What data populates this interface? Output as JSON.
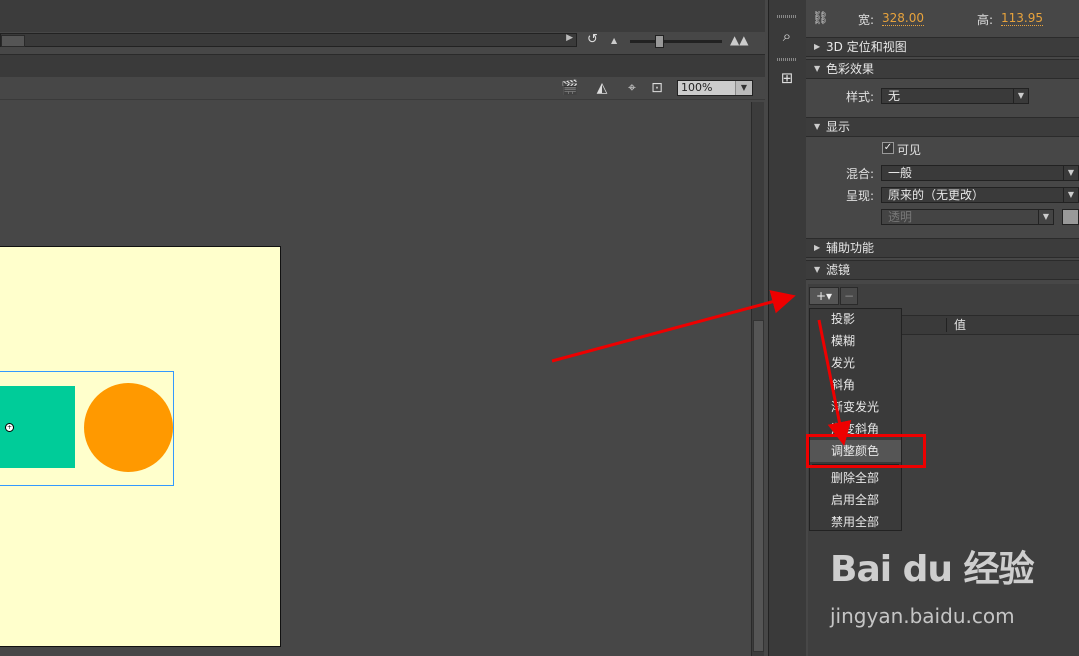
{
  "stage": {
    "zoom_value": "100%",
    "colors": {
      "canvas": "#ffffcc",
      "rect": "#00cc99",
      "circle": "#ff9900",
      "selection": "#3399ff"
    }
  },
  "properties": {
    "size": {
      "width_label": "宽:",
      "width_value": "328.00",
      "height_label": "高:",
      "height_value": "113.95"
    },
    "sections": {
      "position_3d": "3D 定位和视图",
      "color_effect": "色彩效果",
      "display": "显示",
      "accessibility": "辅助功能",
      "filters": "滤镜"
    },
    "color_effect": {
      "style_label": "样式:",
      "style_value": "无"
    },
    "display": {
      "visible_label": "可见",
      "visible_checked": true,
      "blend_label": "混合:",
      "blend_value": "一般",
      "render_label": "呈现:",
      "render_value": "原来的（无更改）",
      "transparency_value": "透明"
    },
    "filters": {
      "add_button": "+▾",
      "remove_button": "−",
      "value_column": "值"
    }
  },
  "filter_menu": {
    "items": [
      "投影",
      "模糊",
      "发光",
      "斜角",
      "渐变发光",
      "渐变斜角",
      "调整颜色",
      "删除全部",
      "启用全部",
      "禁用全部"
    ],
    "highlighted": "调整颜色"
  },
  "annotation": {
    "color": "#ee0000"
  },
  "watermark": {
    "logo": "Bai du 经验",
    "url": "jingyan.baidu.com"
  }
}
